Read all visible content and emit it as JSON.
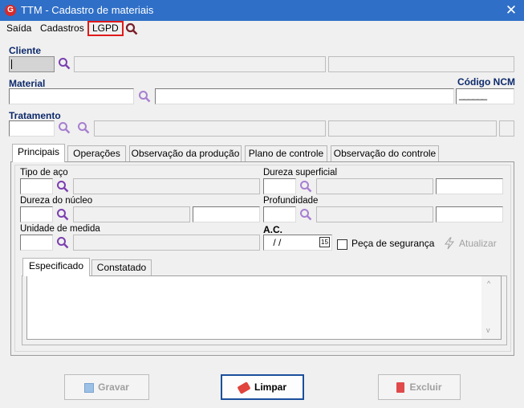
{
  "window": {
    "title": "TTM - Cadastro de materiais",
    "icon_letter": "G",
    "close_glyph": "✕"
  },
  "menu": {
    "items": [
      "Saída",
      "Cadastros",
      "LGPD"
    ]
  },
  "labels": {
    "cliente": "Cliente",
    "material": "Material",
    "codigo_ncm": "Código NCM",
    "tratamento": "Tratamento",
    "tipo_aco": "Tipo de aço",
    "dureza_superficial": "Dureza superficial",
    "dureza_nucleo": "Dureza do núcleo",
    "profundidade": "Profundidade",
    "unidade_medida": "Unidade de medida",
    "ac": "A.C."
  },
  "fields": {
    "ncm_value": "______",
    "ac_date": " / /",
    "ac_date_icon": "15"
  },
  "tabs": [
    "Principais",
    "Operações",
    "Observação da produção",
    "Plano de controle",
    "Observação do controle"
  ],
  "subtabs": [
    "Especificado",
    "Constatado"
  ],
  "checkbox": {
    "label": "Peça de segurança",
    "checked": false
  },
  "atualizar": "Atualizar",
  "buttons": {
    "gravar": "Gravar",
    "limpar": "Limpar",
    "excluir": "Excluir"
  },
  "colors": {
    "titlebar": "#2f6fc7",
    "label_blue": "#0d2a6b",
    "lgpd_highlight": "#e01b1b",
    "lens": "#7b3fb0"
  }
}
